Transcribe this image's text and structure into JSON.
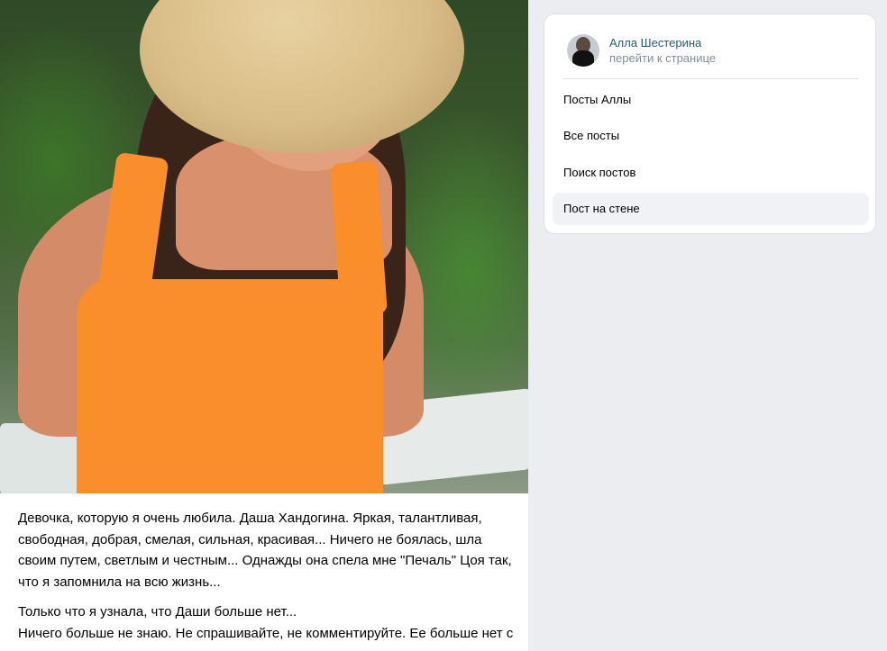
{
  "post": {
    "photo_icon": "photo-of-woman-in-orange-top",
    "paragraphs": [
      "Девочка, которую я очень любила. Даша Хандогина. Яркая, талантливая, свободная, добрая, смелая, сильная, красивая... Ничего не боялась, шла своим путем, светлым и честным... Однажды она спела мне \"Печаль\" Цоя так, что я запомнила на всю жизнь...",
      "Только что я узнала, что Даши больше нет...\nНичего больше не знаю. Не спрашивайте, не комментируйте. Ее больше нет с нами..."
    ]
  },
  "sidebar": {
    "profile_name": "Алла Шестерина",
    "profile_link": "перейти к странице",
    "menu": [
      {
        "label": "Посты Аллы",
        "active": false
      },
      {
        "label": "Все посты",
        "active": false
      },
      {
        "label": "Поиск постов",
        "active": false
      },
      {
        "label": "Пост на стене",
        "active": true
      }
    ]
  },
  "colors": {
    "background": "#ebedf0",
    "link": "#2a5885",
    "muted": "#818c99",
    "active_item": "#f0f2f5"
  }
}
